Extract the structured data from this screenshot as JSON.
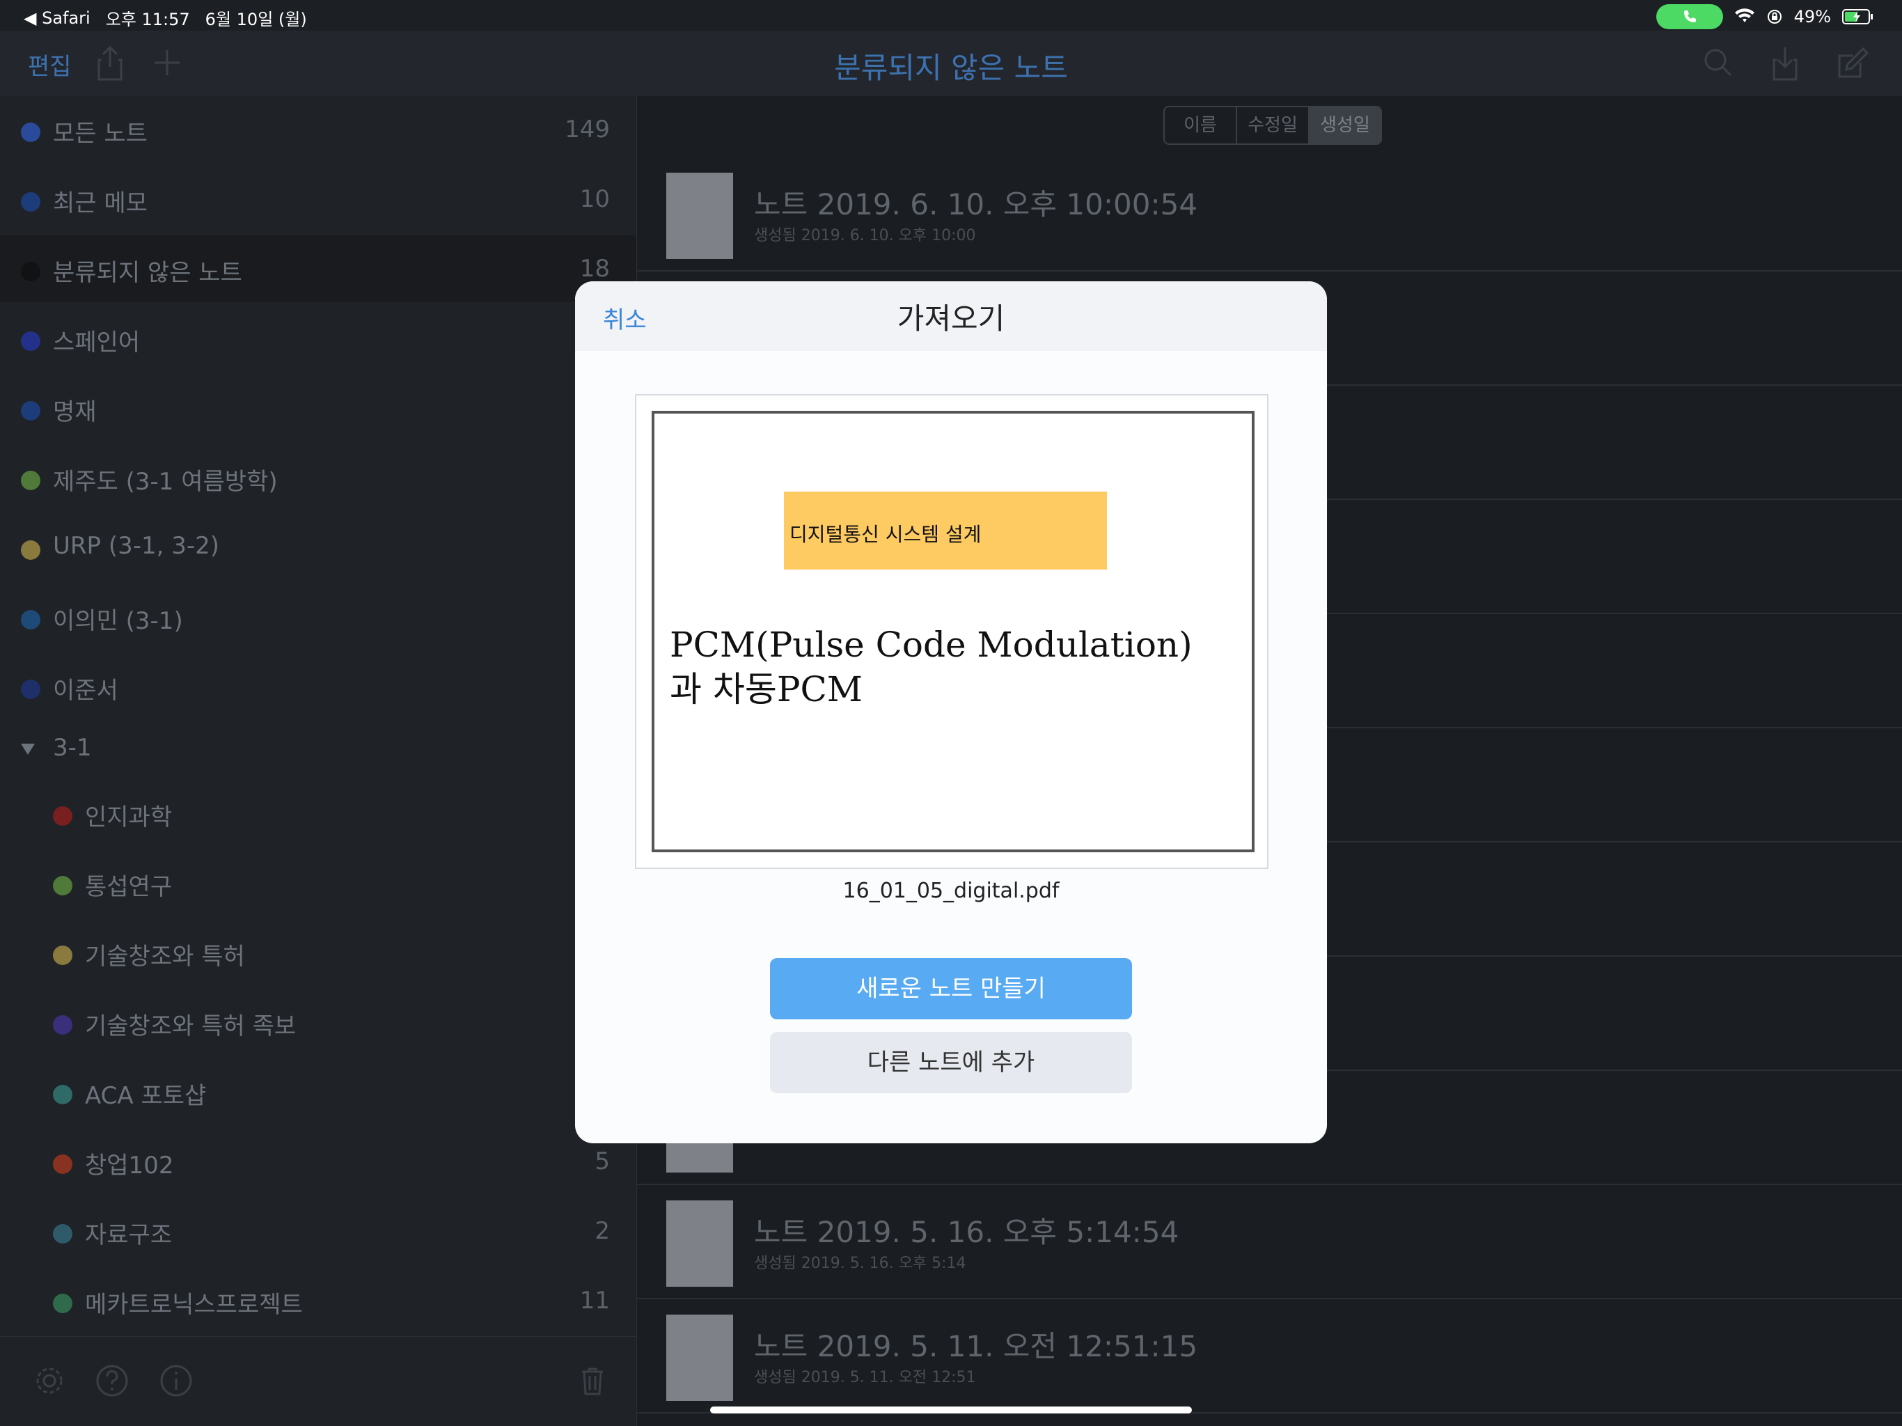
{
  "status_bar": {
    "back_app": "◀ Safari",
    "time": "오후 11:57",
    "date": "6월 10일 (월)",
    "battery": "49%"
  },
  "nav": {
    "edit_label": "편집",
    "title": "분류되지 않은 노트"
  },
  "sidebar": {
    "items": [
      {
        "label": "모든 노트",
        "count": "149",
        "color": "#2a4a9c"
      },
      {
        "label": "최근 메모",
        "count": "10",
        "color": "#1d3c7a"
      },
      {
        "label": "분류되지 않은 노트",
        "count": "18",
        "color": "#111214"
      },
      {
        "label": "스페인어",
        "count": "",
        "color": "#23318a"
      },
      {
        "label": "명재",
        "count": "",
        "color": "#1d3c7a"
      },
      {
        "label": "제주도 (3-1 여름방학)",
        "count": "",
        "color": "#4f7a3a"
      },
      {
        "label": "URP (3-1, 3-2)",
        "count": "",
        "color": "#8a7a3e"
      },
      {
        "label": "이의민 (3-1)",
        "count": "",
        "color": "#1e4a78"
      },
      {
        "label": "이준서",
        "count": "",
        "color": "#1e2f6a"
      },
      {
        "label": "3-1",
        "count": "",
        "color": ""
      },
      {
        "label": "인지과학",
        "count": "",
        "color": "#7a1f1f"
      },
      {
        "label": "통섭연구",
        "count": "",
        "color": "#4f7a3a"
      },
      {
        "label": "기술창조와 특허",
        "count": "",
        "color": "#8a7a3e"
      },
      {
        "label": "기술창조와 특허 족보",
        "count": "",
        "color": "#3a2f7a"
      },
      {
        "label": "ACA 포토샵",
        "count": "",
        "color": "#2f6a66"
      },
      {
        "label": "창업102",
        "count": "5",
        "color": "#8a3222"
      },
      {
        "label": "자료구조",
        "count": "2",
        "color": "#2f5a6a"
      },
      {
        "label": "메카트로닉스프로젝트",
        "count": "11",
        "color": "#2f6a4a"
      }
    ]
  },
  "sort": {
    "options": [
      "이름",
      "수정일",
      "생성일"
    ],
    "selected": "생성일"
  },
  "notes": [
    {
      "title": "노트 2019. 6. 10. 오후 10:00:54",
      "subtitle": "생성됨 2019. 6. 10. 오후 10:00"
    },
    {
      "title": "노트 2019. 5. 16. 오후 5:14:54",
      "subtitle": "생성됨 2019. 5. 16. 오후 5:14"
    },
    {
      "title": "노트 2019. 5. 11. 오전 12:51:15",
      "subtitle": "생성됨 2019. 5. 11. 오전 12:51"
    }
  ],
  "modal": {
    "cancel_label": "취소",
    "title": "가져오기",
    "pdf_banner": "디지털통신 시스템 설계",
    "pdf_heading_line1": "PCM(Pulse Code Modulation)",
    "pdf_heading_line2": "과 차동PCM",
    "filename": "16_01_05_digital.pdf",
    "primary_button": "새로운 노트 만들기",
    "secondary_button": "다른 노트에 추가"
  },
  "colors": {
    "accent": "#3a86d6",
    "primary_button": "#58aaf2",
    "banner": "#fecb63"
  }
}
